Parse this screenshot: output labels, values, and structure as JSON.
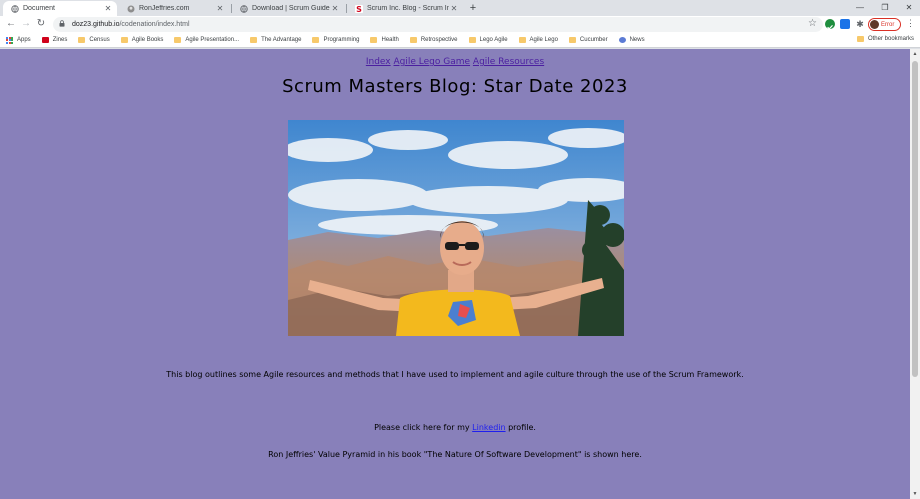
{
  "tabs": [
    {
      "title": "Document",
      "active": true,
      "icon": "globe-icon"
    },
    {
      "title": "RonJeffries.com",
      "active": false,
      "icon": "ron-favicon"
    },
    {
      "title": "Download | Scrum Guides",
      "active": false,
      "icon": "globe-icon"
    },
    {
      "title": "Scrum Inc. Blog - Scrum Inc",
      "active": false,
      "icon": "scrum-inc-favicon"
    }
  ],
  "address": {
    "host": "doz23.github.io",
    "path": "/codenation/index.html"
  },
  "profile": {
    "label": "Error"
  },
  "bookmarks": {
    "apps": "Apps",
    "items": [
      "Zines",
      "Census",
      "Agile Books",
      "Agile Presentation...",
      "The Advantage",
      "Programming",
      "Health",
      "Retrospective",
      "Lego Agile",
      "Agile Lego",
      "Cucumber",
      "News"
    ],
    "other": "Other bookmarks"
  },
  "page": {
    "nav": [
      "Index",
      "Agile Lego Game",
      "Agile Resources"
    ],
    "title": "Scrum Masters Blog: Star Date 2023",
    "hero_alt": "Man with outstretched arms at the Grand Canyon",
    "intro": "This blog outlines some Agile resources and methods that I have used to implement and agile culture through the use of the Scrum Framework.",
    "linkedin_before": "Please click here for my ",
    "linkedin_link": "Linkedin",
    "linkedin_after": " profile.",
    "pyramid_text": "Ron Jeffries' Value Pyramid in his book \"The Nature Of Software Development\" is shown here."
  },
  "colors": {
    "page_bg": "#8880ba",
    "nav_link": "#4b1fa0",
    "body_link": "#1f1fee"
  }
}
